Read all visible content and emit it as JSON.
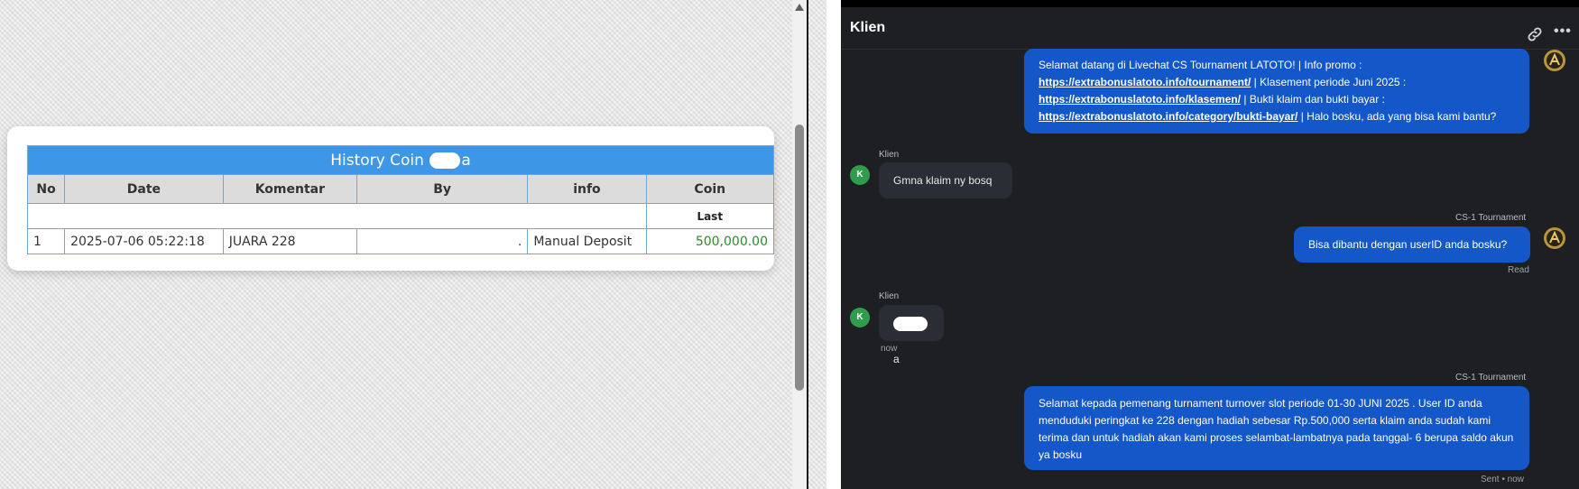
{
  "history": {
    "title_prefix": "History Coin",
    "title_suffix": "a",
    "columns": [
      "No",
      "Date",
      "Komentar",
      "By",
      "info",
      "Coin"
    ],
    "last_label": "Last",
    "rows": [
      {
        "no": "1",
        "date": "2025-07-06 05:22:18",
        "komentar": "JUARA 228",
        "by": ".",
        "info": "Manual Deposit",
        "coin": "500,000.00"
      }
    ]
  },
  "chat": {
    "title": "Klien",
    "messages": {
      "m1": {
        "line1": "Selamat datang di Livechat CS Tournament LATOTO! | Info promo :",
        "link1": "https://extrabonuslatoto.info/tournament/",
        "line2": " | Klasement periode Juni 2025 :",
        "link2": "https://extrabonuslatoto.info/klasemen/",
        "line3": " | Bukti klaim dan bukti bayar :",
        "link3": "https://extrabonuslatoto.info/category/bukti-bayar/",
        "line4": " | Halo bosku, ada yang bisa kami bantu?"
      },
      "m2": {
        "sender": "Klien",
        "avatar": "K",
        "text": "Gmna klaim ny bosq"
      },
      "m3": {
        "sender": "CS-1 Tournament",
        "text": "Bisa dibantu dengan userID anda bosku?",
        "status": "Read"
      },
      "m4": {
        "sender": "Klien",
        "avatar": "K",
        "text_suffix": "a",
        "time": "now"
      },
      "m5": {
        "sender": "CS-1 Tournament",
        "text": "Selamat kepada pemenang turnament turnover slot periode 01-30 JUNI 2025 . User ID anda menduduki peringkat ke 228 dengan hadiah sebesar Rp.500,000 serta klaim anda sudah kami terima dan untuk hadiah akan kami proses selambat-lambatnya pada tanggal- 6 berupa saldo akun ya bosku",
        "status": "Sent • now"
      }
    }
  },
  "colors": {
    "table_header": "#3d97e6",
    "coin_green": "#2c8a2c",
    "chat_bg": "#1d1f23",
    "bubble_out": "#1457c8",
    "bubble_in": "#2a2d33",
    "avatar_green": "#2f9e4c"
  },
  "icons": {
    "header_link": "link-icon",
    "header_more": "more-icon",
    "agent": "agent-logo-icon"
  }
}
